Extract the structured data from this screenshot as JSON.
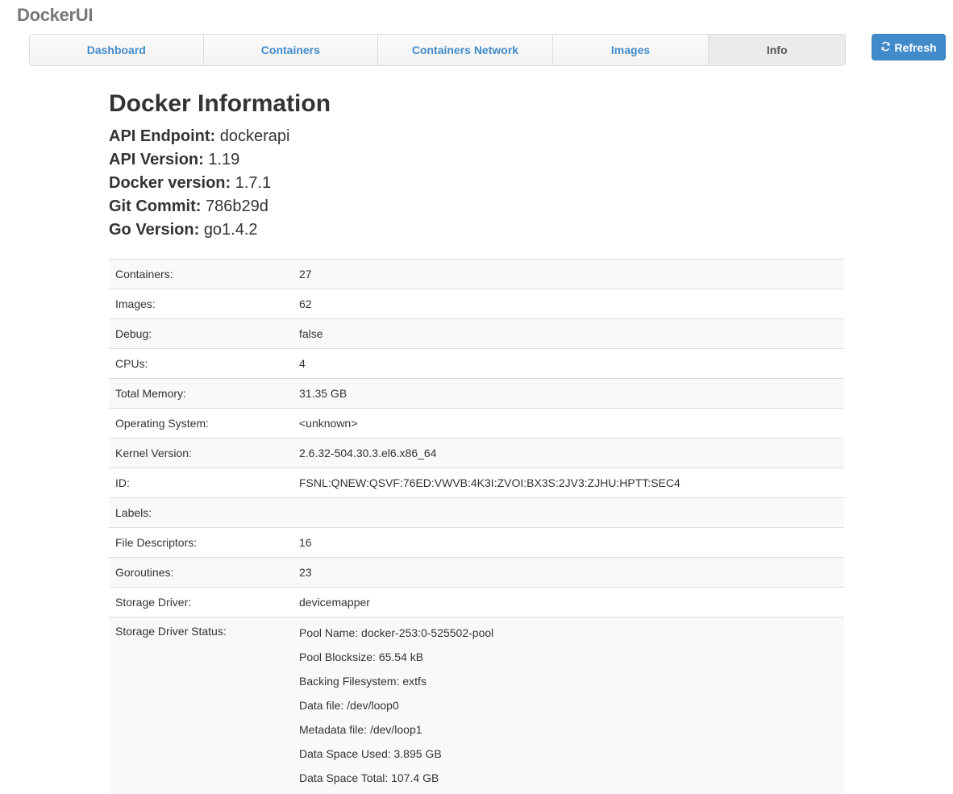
{
  "app": {
    "brand": "DockerUI"
  },
  "nav": {
    "items": [
      {
        "label": "Dashboard"
      },
      {
        "label": "Containers"
      },
      {
        "label": "Containers Network"
      },
      {
        "label": "Images"
      },
      {
        "label": "Info"
      }
    ],
    "active": "Info"
  },
  "toolbar": {
    "refresh_label": "Refresh"
  },
  "page": {
    "title": "Docker Information"
  },
  "summary": [
    {
      "key": "API Endpoint:",
      "value": "dockerapi"
    },
    {
      "key": "API Version:",
      "value": "1.19"
    },
    {
      "key": "Docker version:",
      "value": "1.7.1"
    },
    {
      "key": "Git Commit:",
      "value": "786b29d"
    },
    {
      "key": "Go Version:",
      "value": "go1.4.2"
    }
  ],
  "details": [
    {
      "key": "Containers:",
      "value": "27"
    },
    {
      "key": "Images:",
      "value": "62"
    },
    {
      "key": "Debug:",
      "value": "false"
    },
    {
      "key": "CPUs:",
      "value": "4"
    },
    {
      "key": "Total Memory:",
      "value": "31.35 GB"
    },
    {
      "key": "Operating System:",
      "value": "<unknown>"
    },
    {
      "key": "Kernel Version:",
      "value": "2.6.32-504.30.3.el6.x86_64"
    },
    {
      "key": "ID:",
      "value": "FSNL:QNEW:QSVF:76ED:VWVB:4K3I:ZVOI:BX3S:2JV3:ZJHU:HPTT:SEC4"
    },
    {
      "key": "Labels:",
      "value": ""
    },
    {
      "key": "File Descriptors:",
      "value": "16"
    },
    {
      "key": "Goroutines:",
      "value": "23"
    },
    {
      "key": "Storage Driver:",
      "value": "devicemapper"
    }
  ],
  "storage_status": {
    "key": "Storage Driver Status:",
    "lines": [
      "Pool Name: docker-253:0-525502-pool",
      "Pool Blocksize: 65.54 kB",
      "Backing Filesystem: extfs",
      "Data file: /dev/loop0",
      "Metadata file: /dev/loop1",
      "Data Space Used: 3.895 GB",
      "Data Space Total: 107.4 GB"
    ]
  },
  "colors": {
    "accent": "#428bca",
    "stripe": "#f9f9f9",
    "border": "#dddddd"
  },
  "icons": {
    "refresh": "refresh-icon"
  }
}
